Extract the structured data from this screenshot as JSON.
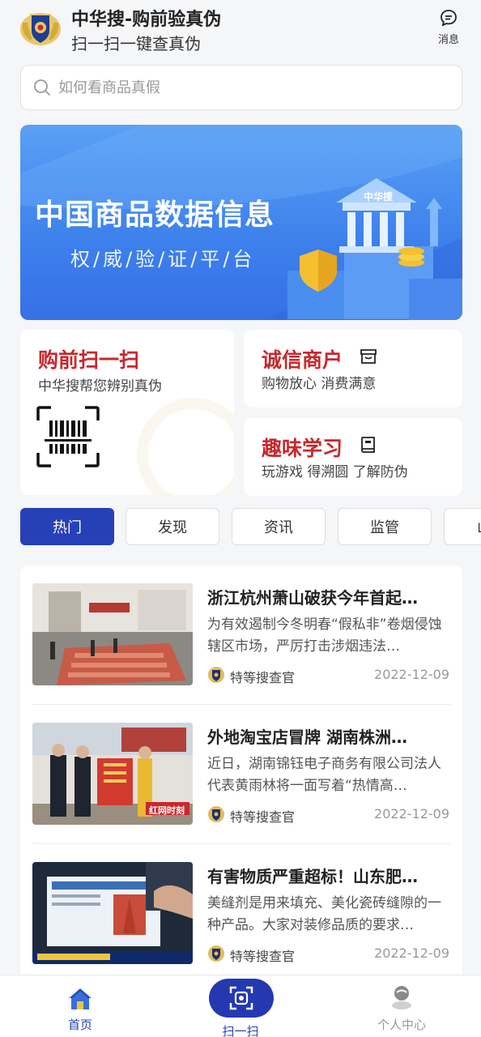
{
  "header": {
    "title": "中华搜-购前验真伪",
    "subtitle": "扫一扫一键查真伪",
    "message_label": "消息"
  },
  "search": {
    "placeholder": "如何看商品真假"
  },
  "banner": {
    "title": "中国商品数据信息",
    "subtitle": "权/威/验/证/平/台",
    "building_label": "中华搜"
  },
  "features": {
    "scan": {
      "title": "购前扫一扫",
      "desc": "中华搜帮您辨别真伪"
    },
    "merchant": {
      "title": "诚信商户",
      "desc": "购物放心 消费满意"
    },
    "learn": {
      "title": "趣味学习",
      "desc": "玩游戏 得溯圆 了解防伪"
    }
  },
  "tabs": [
    {
      "label": "热门",
      "active": true
    },
    {
      "label": "发现",
      "active": false
    },
    {
      "label": "资讯",
      "active": false
    },
    {
      "label": "监管",
      "active": false
    },
    {
      "label": "山",
      "active": false
    }
  ],
  "news": [
    {
      "title": "浙江杭州萧山破获今年首起…",
      "summary": "为有效遏制今冬明春“假私非”卷烟侵蚀辖区市场，严厉打击涉烟违法…",
      "author": "特等搜查官",
      "date": "2022-12-09"
    },
    {
      "title": "外地淘宝店冒牌 湖南株洲…",
      "summary": "近日，湖南锦钰电子商务有限公司法人代表黄雨林将一面写着“热情高…",
      "author": "特等搜查官",
      "date": "2022-12-09",
      "thumb_watermark": "红网时刻"
    },
    {
      "title": "有害物质严重超标！山东肥…",
      "summary": "美缝剂是用来填充、美化瓷砖缝隙的一种产品。大家对装修品质的要求…",
      "author": "特等搜查官",
      "date": "2022-12-09"
    }
  ],
  "bottom_nav": {
    "home": "首页",
    "scan": "扫一扫",
    "profile": "个人中心"
  },
  "colors": {
    "accent": "#2640b8",
    "feature_title": "#c8282d",
    "banner": "#3d80ec"
  }
}
